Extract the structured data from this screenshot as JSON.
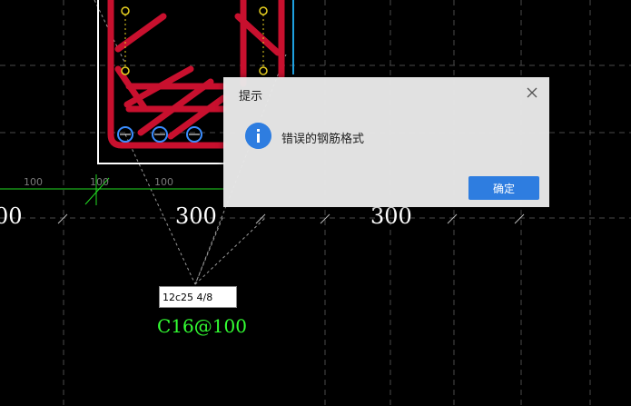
{
  "drawing": {
    "dimensions": {
      "left_partial": "00",
      "center": "300",
      "right": "300"
    },
    "small_dimensions": [
      "100",
      "100",
      "100"
    ],
    "rebar_spec": "C16@100",
    "command_input_value": "12c25 4/8"
  },
  "dialog": {
    "title": "提示",
    "message": "错误的钢筋格式",
    "ok_label": "确定",
    "icon": "info-icon",
    "close_icon": "close-icon"
  },
  "colors": {
    "background": "#000000",
    "rebar": "#c8102e",
    "stirrup_circle": "#3a8dff",
    "dimension_text": "#ffffff",
    "label_green": "#33ff33",
    "blue_line": "#1ea0e0",
    "dialog_accent": "#2e7de0"
  }
}
